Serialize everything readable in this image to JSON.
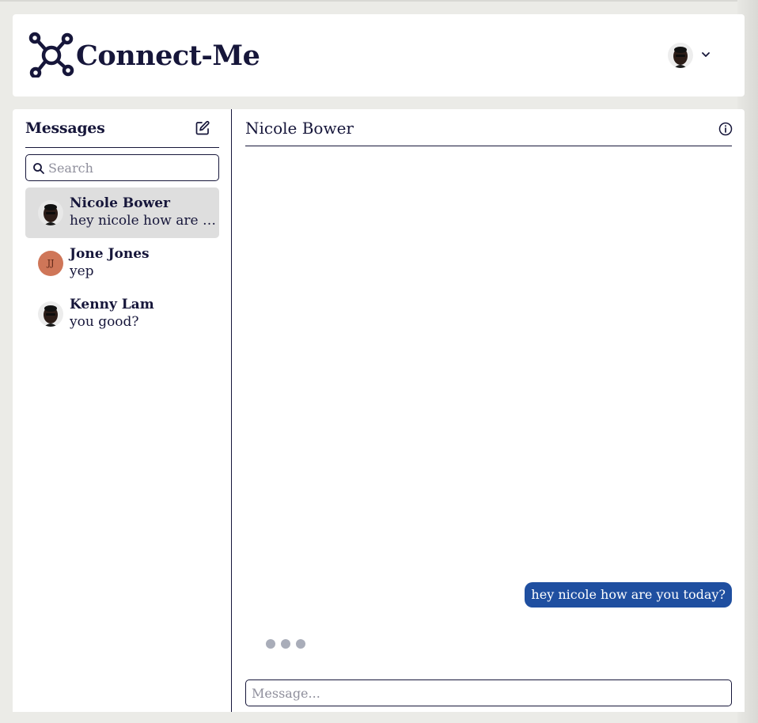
{
  "header": {
    "brand": "Connect-Me",
    "logo_icon": "network-nodes-icon",
    "user_menu_icon": "chevron-down-icon"
  },
  "sidebar": {
    "title": "Messages",
    "compose_icon": "compose-icon",
    "search": {
      "placeholder": "Search",
      "value": ""
    },
    "conversations": [
      {
        "name": "Nicole Bower",
        "preview": "hey nicole how are you today?",
        "avatar": "photo",
        "active": true
      },
      {
        "name": "Jone Jones",
        "preview": "yep",
        "avatar": "initials",
        "initials": "JJ",
        "active": false
      },
      {
        "name": "Kenny Lam",
        "preview": "you good?",
        "avatar": "photo",
        "active": false
      }
    ]
  },
  "chat": {
    "title": "Nicole Bower",
    "info_icon": "info-icon",
    "messages": [
      {
        "text": "hey nicole how are you today?",
        "sender": "me"
      }
    ],
    "typing_indicator": true,
    "composer": {
      "placeholder": "Message...",
      "value": ""
    }
  },
  "colors": {
    "brand": "#16163a",
    "bubble": "#1f4fa0",
    "active_row": "#dedede",
    "initials_avatar": "#cf7658",
    "page_bg": "#ebebe7"
  }
}
